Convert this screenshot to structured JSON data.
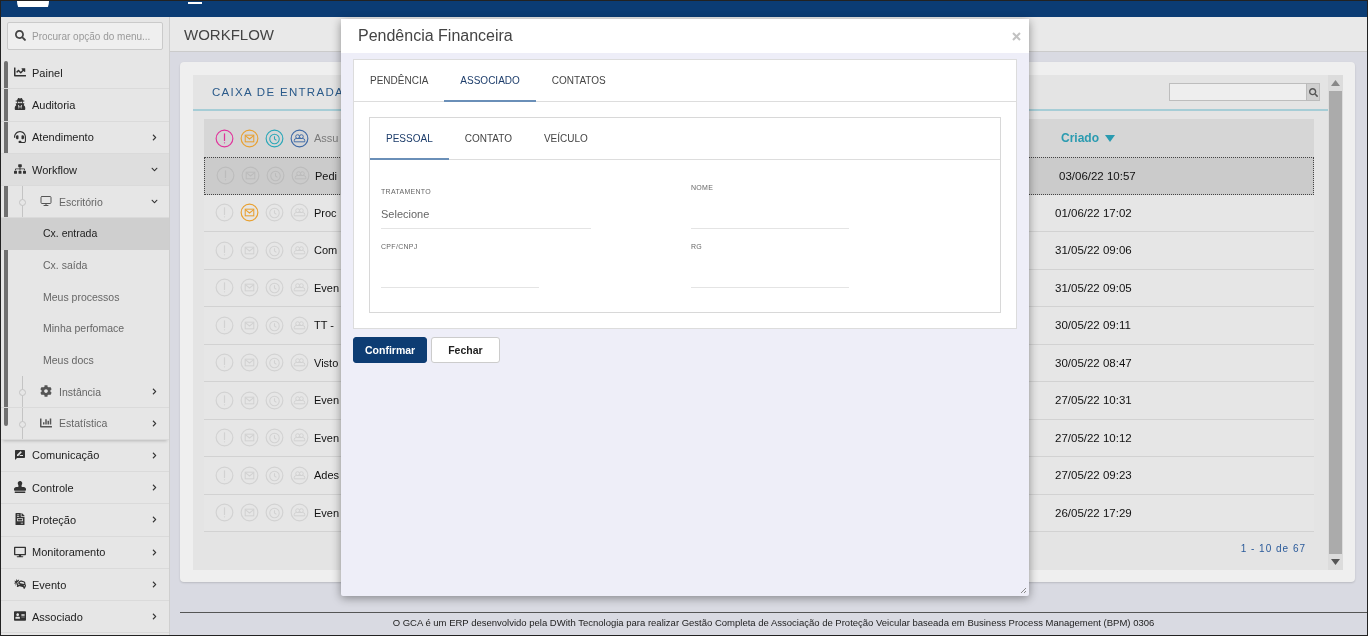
{
  "sidebar": {
    "search": {
      "placeholder": "Procurar opção do menu..."
    },
    "items": [
      {
        "label": "Painel",
        "selected": false
      },
      {
        "label": "Auditoria",
        "selected": false
      },
      {
        "label": "Atendimento",
        "selected": false,
        "expanded": false
      },
      {
        "label": "Workflow",
        "selected": false,
        "expanded": true,
        "children": [
          {
            "label": "Escritório",
            "selected": false,
            "expanded": true,
            "children": [
              {
                "label": "Cx. entrada",
                "selected": true
              },
              {
                "label": "Cx. saída",
                "selected": false
              },
              {
                "label": "Meus processos",
                "selected": false
              },
              {
                "label": "Minha perfomace",
                "selected": false
              },
              {
                "label": "Meus docs",
                "selected": false
              }
            ]
          },
          {
            "label": "Instância",
            "selected": false,
            "expanded": false
          },
          {
            "label": "Estatística",
            "selected": false,
            "expanded": false
          }
        ]
      },
      {
        "label": "Comunicação",
        "selected": false,
        "expanded": false
      },
      {
        "label": "Controle",
        "selected": false,
        "expanded": false
      },
      {
        "label": "Proteção",
        "selected": false,
        "expanded": false
      },
      {
        "label": "Monitoramento",
        "selected": false,
        "expanded": false
      },
      {
        "label": "Evento",
        "selected": false,
        "expanded": false
      },
      {
        "label": "Associado",
        "selected": false,
        "expanded": false
      }
    ]
  },
  "page": {
    "title": "WORKFLOW"
  },
  "inbox": {
    "title": "CAIXA DE ENTRADA",
    "columns": [
      "Assu",
      "Criado"
    ],
    "rows": [
      {
        "subject": "Pedi",
        "created": "03/06/22 10:57",
        "selected": true,
        "mail": false
      },
      {
        "subject": "Proc",
        "created": "01/06/22 17:02",
        "selected": false,
        "mail": true
      },
      {
        "subject": "Com",
        "created": "31/05/22 09:06",
        "selected": false,
        "mail": false
      },
      {
        "subject": "Even",
        "created": "31/05/22 09:05",
        "selected": false,
        "mail": false
      },
      {
        "subject": "TT -",
        "created": "30/05/22 09:11",
        "selected": false,
        "mail": false
      },
      {
        "subject": "Visto",
        "created": "30/05/22 08:47",
        "selected": false,
        "mail": false
      },
      {
        "subject": "Even",
        "created": "27/05/22 10:31",
        "selected": false,
        "mail": false
      },
      {
        "subject": "Even",
        "created": "27/05/22 10:12",
        "selected": false,
        "mail": false
      },
      {
        "subject": "Ades",
        "created": "27/05/22 09:23",
        "selected": false,
        "mail": false
      },
      {
        "subject": "Even",
        "created": "26/05/22 17:29",
        "selected": false,
        "mail": false
      }
    ],
    "pagination": "1 - 10 de 67"
  },
  "dialog": {
    "title": "Pendência Financeira",
    "tabs": [
      {
        "label": "PENDÊNCIA",
        "selected": false
      },
      {
        "label": "ASSOCIADO",
        "selected": true
      },
      {
        "label": "CONTATOS",
        "selected": false
      }
    ],
    "subtabs": [
      {
        "label": "PESSOAL",
        "selected": true
      },
      {
        "label": "CONTATO",
        "selected": false
      },
      {
        "label": "VEÍCULO",
        "selected": false
      }
    ],
    "fields": [
      {
        "label": "TRATAMENTO",
        "kind": "select",
        "placeholder": "Selecione"
      },
      {
        "label": "NOME",
        "kind": "text"
      },
      {
        "label": "CPF/CNPJ",
        "kind": "text"
      },
      {
        "label": "RG",
        "kind": "text"
      }
    ],
    "buttons": [
      {
        "label": "Confirmar",
        "kind": "primary"
      },
      {
        "label": "Fechar",
        "kind": "secondary"
      }
    ]
  },
  "footer": "O GCA é um ERP desenvolvido pela DWith Tecnologia para realizar Gestão Completa de Associação de Proteção Veicular baseada em Business Process Management (BPM) 0306"
}
